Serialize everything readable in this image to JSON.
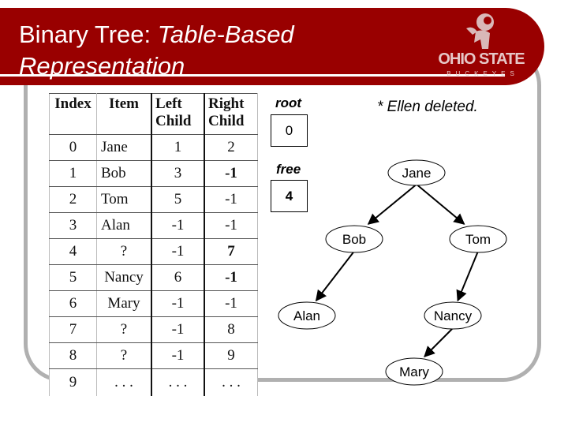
{
  "header": {
    "title_plain": "Binary Tree: ",
    "title_italic_1": "Table-Based",
    "title_italic_2": "Representation",
    "logo": {
      "main": "OHIO STATE",
      "sub": "BUCKEYES",
      "icon": "brutus-mascot-icon"
    },
    "brand_color": "#990000"
  },
  "table": {
    "headers": [
      "Index",
      "Item",
      "Left Child",
      "Right Child"
    ],
    "header_lines": [
      [
        "Index"
      ],
      [
        "Item"
      ],
      [
        "Left",
        "Child"
      ],
      [
        "Right",
        "Child"
      ]
    ],
    "rows": [
      {
        "index": "0",
        "item": "Jane",
        "left": "1",
        "right": "2"
      },
      {
        "index": "1",
        "item": "Bob",
        "left": "3",
        "right": "-1"
      },
      {
        "index": "2",
        "item": "Tom",
        "left": "5",
        "right": "-1"
      },
      {
        "index": "3",
        "item": "Alan",
        "left": "-1",
        "right": "-1"
      },
      {
        "index": "4",
        "item": "?",
        "left": "-1",
        "right": "7"
      },
      {
        "index": "5",
        "item": "Nancy",
        "left": "6",
        "right": "-1"
      },
      {
        "index": "6",
        "item": "Mary",
        "left": "-1",
        "right": "-1"
      },
      {
        "index": "7",
        "item": "?",
        "left": "-1",
        "right": "8"
      },
      {
        "index": "8",
        "item": "?",
        "left": "-1",
        "right": "9"
      },
      {
        "index": "9",
        "item": ". . .",
        "left": ". . .",
        "right": ". . ."
      }
    ]
  },
  "pointers": {
    "root": {
      "label": "root",
      "value": "0"
    },
    "free": {
      "label": "free",
      "value": "4"
    }
  },
  "note": "* Ellen deleted.",
  "tree": {
    "nodes": [
      {
        "id": "jane",
        "label": "Jane"
      },
      {
        "id": "bob",
        "label": "Bob"
      },
      {
        "id": "tom",
        "label": "Tom"
      },
      {
        "id": "alan",
        "label": "Alan"
      },
      {
        "id": "nancy",
        "label": "Nancy"
      },
      {
        "id": "mary",
        "label": "Mary"
      }
    ],
    "edges": [
      {
        "from": "jane",
        "to": "bob"
      },
      {
        "from": "jane",
        "to": "tom"
      },
      {
        "from": "bob",
        "to": "alan"
      },
      {
        "from": "tom",
        "to": "nancy"
      },
      {
        "from": "nancy",
        "to": "mary"
      }
    ]
  }
}
